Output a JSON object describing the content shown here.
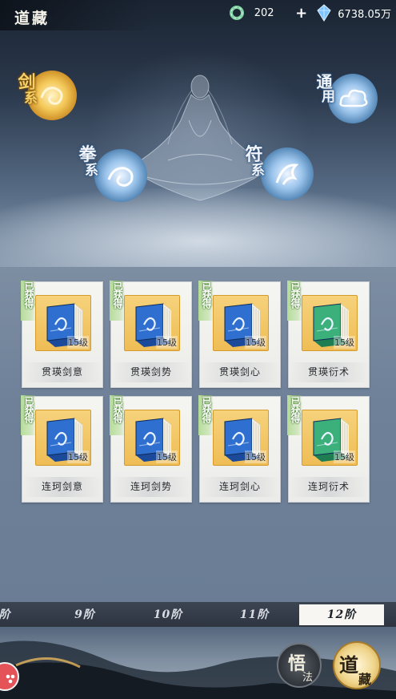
{
  "header": {
    "title": "道藏",
    "currency_1_value": "202",
    "currency_2_value": "6738.05万",
    "add_label": "+"
  },
  "scene": {
    "sword_label_1": "剑",
    "sword_label_2": "系",
    "fist_label_1": "拳",
    "fist_label_2": "系",
    "talisman_label_1": "符",
    "talisman_label_2": "系",
    "general_label_1": "通",
    "general_label_2": "用"
  },
  "cards": [
    {
      "name": "贯瑛剑意",
      "tag": "已获得",
      "level": "15级",
      "color": "blue"
    },
    {
      "name": "贯瑛剑势",
      "tag": "已获得",
      "level": "15级",
      "color": "blue"
    },
    {
      "name": "贯瑛剑心",
      "tag": "已获得",
      "level": "15级",
      "color": "blue"
    },
    {
      "name": "贯瑛衍术",
      "tag": "已获得",
      "level": "15级",
      "color": "green"
    },
    {
      "name": "连珂剑意",
      "tag": "已获得",
      "level": "15级",
      "color": "blue"
    },
    {
      "name": "连珂剑势",
      "tag": "已获得",
      "level": "15级",
      "color": "blue"
    },
    {
      "name": "连珂剑心",
      "tag": "已获得",
      "level": "15级",
      "color": "blue"
    },
    {
      "name": "连珂衍术",
      "tag": "已获得",
      "level": "15级",
      "color": "green"
    }
  ],
  "tabs": [
    {
      "label": "阶"
    },
    {
      "label": "9阶"
    },
    {
      "label": "10阶"
    },
    {
      "label": "11阶"
    },
    {
      "label": "12阶"
    }
  ],
  "active_tab_index": 4,
  "bottom": {
    "wufa_1": "悟",
    "wufa_2": "法",
    "daozang_1": "道",
    "daozang_2": "藏"
  },
  "colors": {
    "tag_green": "#b6dd9a",
    "item_gold": "#efbd55",
    "book_blue": "#2f6fd0",
    "book_green": "#3bb07a"
  }
}
